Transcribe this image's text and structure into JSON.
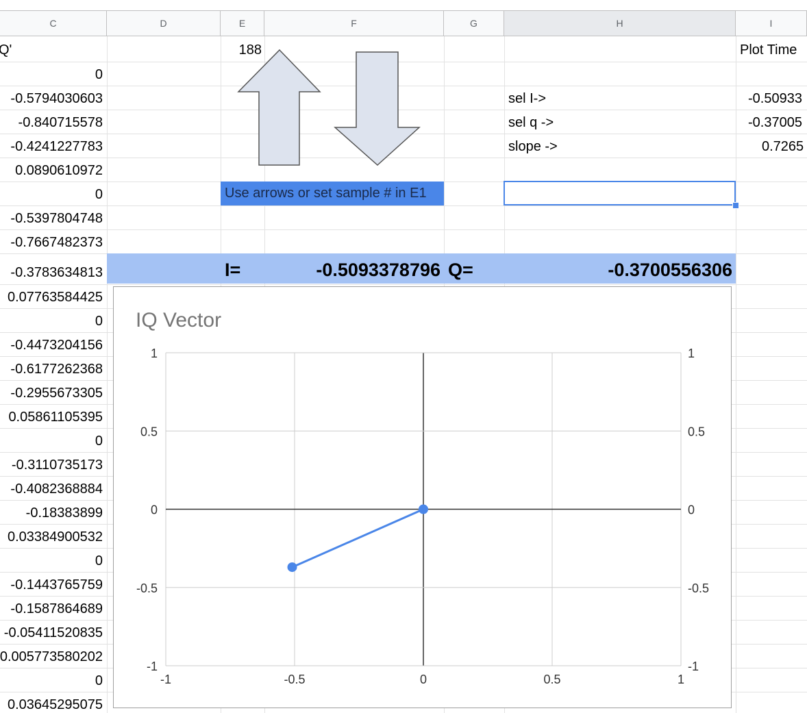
{
  "columns": [
    "C",
    "D",
    "E",
    "F",
    "G",
    "H",
    "I"
  ],
  "selected_column": "H",
  "sheet": {
    "c_header": "Q'",
    "c_values": [
      "0",
      "-0.5794030603",
      "-0.840715578",
      "-0.4241227783",
      "0.0890610972",
      "0",
      "-0.5397804748",
      "-0.7667482373",
      "-0.3783634813",
      "0.07763584425",
      "0",
      "-0.4473204156",
      "-0.6177262368",
      "-0.2955673305",
      "0.05861105395",
      "0",
      "-0.3110735173",
      "-0.4082368884",
      "-0.18383899",
      "0.03384900532",
      "0",
      "-0.1443765759",
      "-0.1587864689",
      "-0.05411520835",
      "0.005773580202",
      "0",
      "0.03645295075"
    ],
    "e1_value": "188",
    "i_header": "Plot Time",
    "labels": {
      "sel_i": "sel I->",
      "sel_q": "sel q ->",
      "slope": "slope ->"
    },
    "i_values": [
      "-0.50933",
      "-0.37005",
      "0.7265"
    ],
    "note": "Use arrows or set sample # in E1",
    "i_label": "I=",
    "i_value": "-0.5093378796",
    "q_label": "Q=",
    "q_value": "-0.3700556306"
  },
  "colors": {
    "accent": "#4a86e8",
    "band": "#a4c2f4",
    "series": "#4a86e8",
    "arrow_fill": "#dde3ee"
  },
  "chart_data": {
    "type": "line",
    "title": "IQ Vector",
    "xlim": [
      -1,
      1
    ],
    "ylim": [
      -1,
      1
    ],
    "x_ticks": [
      "-1",
      "-0.5",
      "0",
      "0.5",
      "1"
    ],
    "y_ticks": [
      "1",
      "0.5",
      "0",
      "-0.5",
      "-1"
    ],
    "y_ticks_right": [
      "1",
      "0.5",
      "0",
      "-0.5",
      "-1"
    ],
    "grid": true,
    "series": [
      {
        "x": [
          -0.5093,
          0
        ],
        "y": [
          -0.3701,
          0
        ]
      }
    ]
  }
}
